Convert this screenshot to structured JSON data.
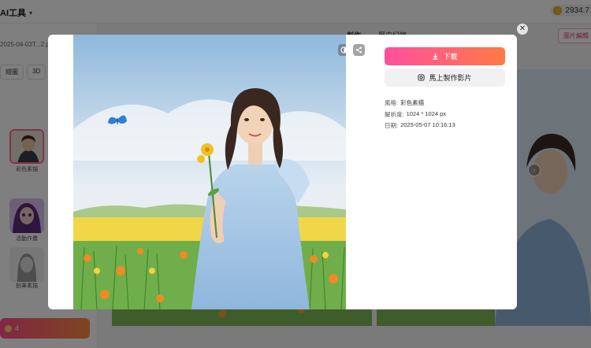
{
  "app": {
    "brand": "AI工具",
    "coins": "2934.7",
    "tabs": [
      "創作",
      "歷史紀錄"
    ],
    "top_right_button": "圖片編輯"
  },
  "sidebar": {
    "filename": "2025-04-03T...2.png",
    "chips": [
      "繪圖",
      "3D"
    ],
    "styles": [
      {
        "label": "彩色素描",
        "selected": true
      },
      {
        "label": "活動作畫",
        "selected": false
      },
      {
        "label": "鉛筆素描",
        "selected": false
      }
    ],
    "generate_count": "4"
  },
  "modal": {
    "download_label": "下載",
    "make_video_label": "馬上製作影片",
    "meta": {
      "style_key": "風格:",
      "style_value": "彩色素描",
      "resolution_key": "解析度:",
      "resolution_value": "1024 * 1024 px",
      "date_key": "日期:",
      "date_value": "2025-05-07 10:16:13"
    },
    "close_label": "✕"
  },
  "icons": [
    "chevron-down-icon",
    "coin-icon",
    "download-icon",
    "video-icon",
    "compare-icon",
    "share-icon",
    "close-icon",
    "chevron-right-icon"
  ],
  "colors": {
    "accent_start": "#ff4fa0",
    "accent_end": "#ff7a45",
    "overlay": "rgba(0,0,0,0.5)"
  }
}
